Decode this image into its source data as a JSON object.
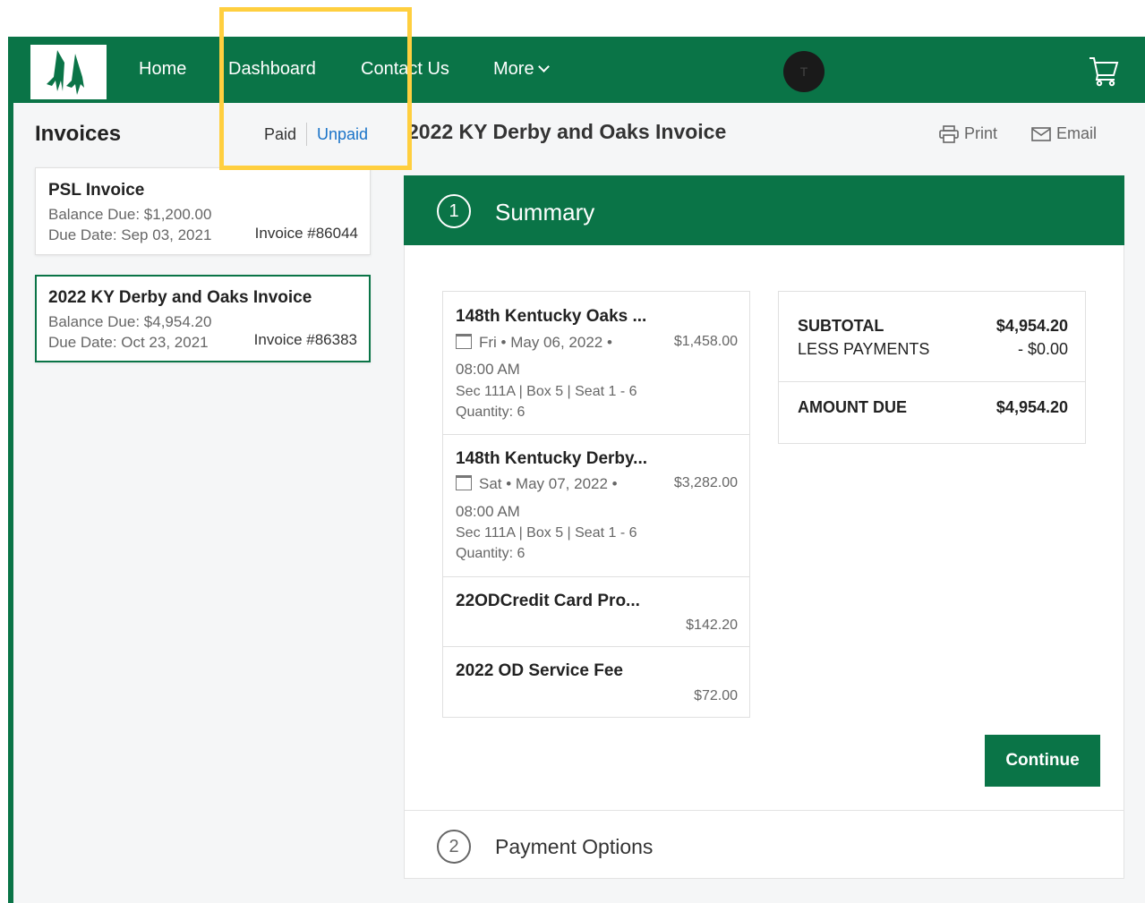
{
  "nav": {
    "items": [
      "Home",
      "Dashboard",
      "Contact Us",
      "More"
    ],
    "avatar_initial": "T"
  },
  "invoices": {
    "heading": "Invoices",
    "filter_paid": "Paid",
    "filter_unpaid": "Unpaid",
    "list": [
      {
        "title": "PSL Invoice",
        "balance": "Balance Due: $1,200.00",
        "due": "Due Date: Sep 03, 2021",
        "number": "Invoice #86044"
      },
      {
        "title": "2022 KY Derby and Oaks Invoice",
        "balance": "Balance Due: $4,954.20",
        "due": "Due Date: Oct 23, 2021",
        "number": "Invoice #86383"
      }
    ]
  },
  "detail": {
    "title": "2022 KY Derby and Oaks Invoice",
    "print_label": "Print",
    "email_label": "Email",
    "step1_number": "1",
    "step1_label": "Summary",
    "step2_number": "2",
    "step2_label": "Payment Options",
    "continue_label": "Continue",
    "items": [
      {
        "title": "148th Kentucky Oaks ...",
        "date": "Fri • May 06, 2022 •",
        "price": "$1,458.00",
        "time": "08:00 AM",
        "seat": "Sec 111A | Box 5  |  Seat 1 - 6",
        "qty": "Quantity: 6"
      },
      {
        "title": "148th Kentucky Derby...",
        "date": "Sat • May 07, 2022 •",
        "price": "$3,282.00",
        "time": "08:00 AM",
        "seat": "Sec 111A | Box 5  |  Seat 1 - 6",
        "qty": "Quantity: 6"
      },
      {
        "title": "22ODCredit Card Pro...",
        "price": "$142.20"
      },
      {
        "title": "2022 OD Service Fee",
        "price": "$72.00"
      }
    ],
    "summary": {
      "subtotal_label": "SUBTOTAL",
      "subtotal_value": "$4,954.20",
      "less_label": "LESS PAYMENTS",
      "less_value": "- $0.00",
      "due_label": "AMOUNT DUE",
      "due_value": "$4,954.20"
    }
  },
  "colors": {
    "brand": "#0a7447",
    "link": "#1a73c8",
    "highlight": "#ffcf3f"
  },
  "icons": [
    "logo-icon",
    "cart-icon",
    "printer-icon",
    "mail-icon",
    "calendar-icon",
    "chevron-down-icon"
  ]
}
